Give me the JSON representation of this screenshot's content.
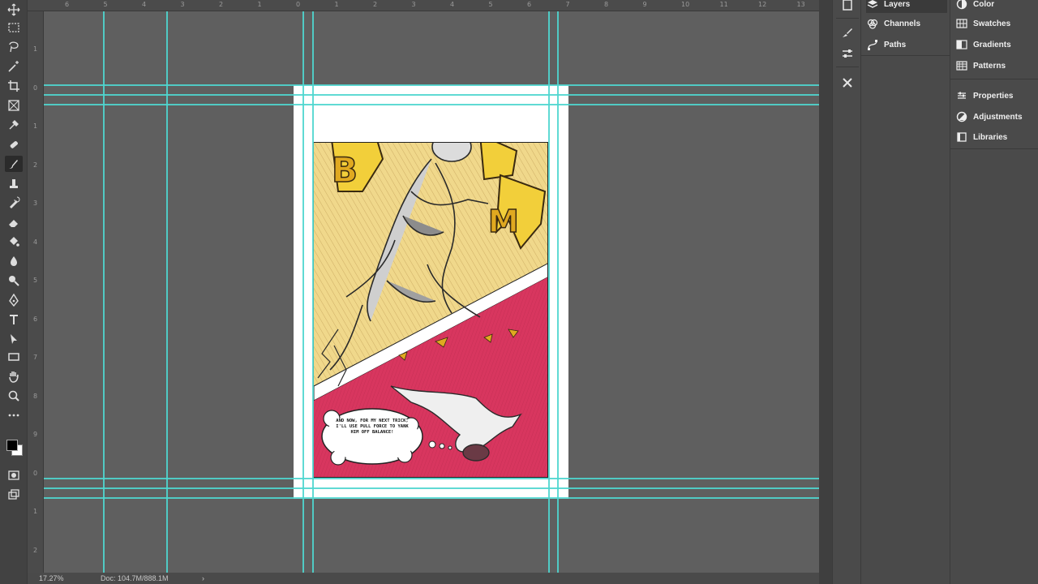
{
  "status": {
    "zoom": "17.27%",
    "doc_size": "Doc: 104.7M/888.1M",
    "arrow": "›"
  },
  "rulers": {
    "top": [
      "6",
      "5",
      "4",
      "3",
      "2",
      "1",
      "0",
      "1",
      "2",
      "3",
      "4",
      "5",
      "6",
      "7",
      "8",
      "9",
      "10",
      "11",
      "12",
      "13"
    ],
    "left": [
      "1",
      "0",
      "1",
      "2",
      "3",
      "4",
      "5",
      "6",
      "7",
      "8",
      "9",
      "0",
      "1",
      "2"
    ]
  },
  "tools": [
    {
      "name": "move-tool-icon"
    },
    {
      "name": "marquee-tool-icon"
    },
    {
      "name": "lasso-tool-icon"
    },
    {
      "name": "magic-wand-tool-icon"
    },
    {
      "name": "crop-tool-icon"
    },
    {
      "name": "frame-tool-icon"
    },
    {
      "name": "eyedropper-tool-icon"
    },
    {
      "name": "healing-brush-tool-icon"
    },
    {
      "name": "brush-tool-icon",
      "active": true
    },
    {
      "name": "clone-stamp-tool-icon"
    },
    {
      "name": "history-brush-tool-icon"
    },
    {
      "name": "eraser-tool-icon"
    },
    {
      "name": "paint-bucket-tool-icon"
    },
    {
      "name": "blur-tool-icon"
    },
    {
      "name": "dodge-tool-icon"
    },
    {
      "name": "pen-tool-icon"
    },
    {
      "name": "type-tool-icon"
    },
    {
      "name": "path-selection-tool-icon"
    },
    {
      "name": "rectangle-tool-icon"
    },
    {
      "name": "hand-tool-icon"
    },
    {
      "name": "zoom-tool-icon"
    },
    {
      "name": "more-tools-icon"
    }
  ],
  "panels": {
    "col1": [
      {
        "label": "Layers",
        "icon": "layers-icon",
        "selected": true
      },
      {
        "label": "Channels",
        "icon": "channels-icon"
      },
      {
        "label": "Paths",
        "icon": "paths-icon"
      }
    ],
    "col2": [
      {
        "label": "Color",
        "icon": "color-icon"
      },
      {
        "label": "Swatches",
        "icon": "swatches-icon"
      },
      {
        "label": "Gradients",
        "icon": "gradients-icon"
      },
      {
        "label": "Patterns",
        "icon": "patterns-icon"
      },
      {
        "label": "Properties",
        "icon": "properties-icon"
      },
      {
        "label": "Adjustments",
        "icon": "adjustments-icon"
      },
      {
        "label": "Libraries",
        "icon": "libraries-icon"
      }
    ]
  },
  "comic": {
    "sfx": "BOOM",
    "thought_bubble": "AND NOW, FOR MY NEXT TRICK, I'LL USE PULL FORCE TO YANK HIM OFF BALANCE!",
    "colors": {
      "yellow": "#f2cf3a",
      "magenta": "#d8365f",
      "paper": "#ffffff",
      "guide": "#4fd6cf"
    }
  }
}
